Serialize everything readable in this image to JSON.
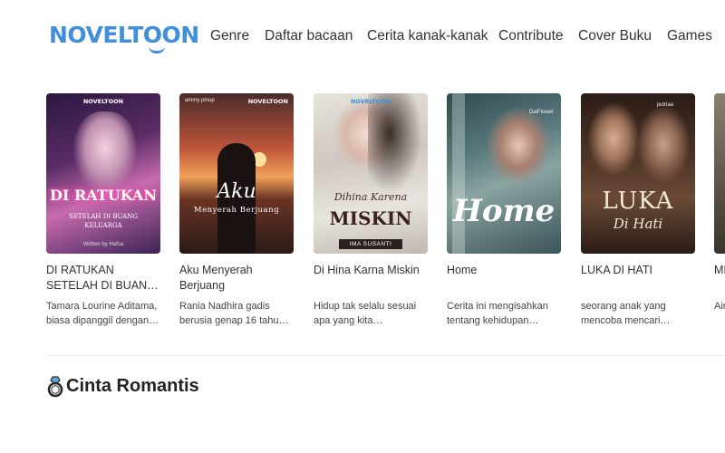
{
  "header": {
    "logo_text": "NOVELTOON",
    "nav": [
      "Genre",
      "Daftar bacaan",
      "Cerita kanak-kanak",
      "Contribute",
      "Cover Buku",
      "Games"
    ]
  },
  "books": [
    {
      "title": "DI RATUKAN SETELAH DI BUAN…",
      "desc": "Tamara Lourine Aditama, biasa dipanggil dengan…",
      "cover": {
        "main": "DI RATUKAN",
        "sub": "SETELAH DI BUANG KELUARGA",
        "author": "Written by Hafsa",
        "brand": "NOVELTOON"
      }
    },
    {
      "title": "Aku Menyerah Berjuang",
      "desc": "Rania Nadhira gadis berusia genap 16 tahu…",
      "cover": {
        "main": "Aku",
        "sub": "Menyerah Berjuang",
        "author": "ammy pinup",
        "brand": "NOVELTOON"
      }
    },
    {
      "title": "Di Hina Karna Miskin",
      "desc": "Hidup tak selalu sesuai apa yang kita…",
      "cover": {
        "main": "Dihina Karena",
        "sub": "MISKIN",
        "author": "IMA SUSANTI",
        "brand": "NOVELTOON"
      }
    },
    {
      "title": "Home",
      "desc": "Cerita ini mengisahkan tentang kehidupan…",
      "cover": {
        "main": "Home",
        "author": "DaiFlower"
      }
    },
    {
      "title": "LUKA DI HATI",
      "desc": "seorang anak yang mencoba mencari…",
      "cover": {
        "main": "LUKA",
        "sub": "Di Hati",
        "author": "putriaa"
      }
    },
    {
      "title": "MI IB…",
      "desc": "Air ke…"
    }
  ],
  "section": {
    "title": "Cinta Romantis",
    "icon": "ring-icon"
  }
}
